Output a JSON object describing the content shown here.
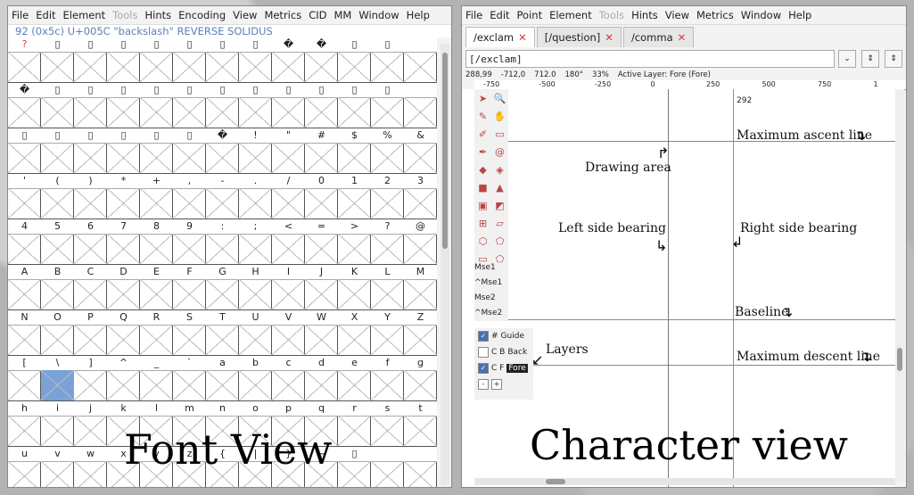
{
  "font_view": {
    "menu": [
      "File",
      "Edit",
      "Element",
      "Tools",
      "Hints",
      "Encoding",
      "View",
      "Metrics",
      "CID",
      "MM",
      "Window",
      "Help"
    ],
    "disabled_menu": [
      "Tools"
    ],
    "info_line": "92 (0x5c) U+005C \"backslash\" REVERSE SOLIDUS",
    "rows": [
      [
        "?",
        "▯",
        "▯",
        "▯",
        "▯",
        "▯",
        "▯",
        "▯",
        "�",
        "�",
        "▯",
        "▯"
      ],
      [
        "�",
        "▯",
        "▯",
        "▯",
        "▯",
        "▯",
        "▯",
        "▯",
        "▯",
        "▯",
        "▯",
        "▯"
      ],
      [
        "▯",
        "▯",
        "▯",
        "▯",
        "▯",
        "▯",
        "�",
        "!",
        "\"",
        "#",
        "$",
        "%",
        "&"
      ],
      [
        "'",
        "(",
        ")",
        "*",
        "+",
        ",",
        "-",
        ".",
        "/",
        "0",
        "1",
        "2",
        "3"
      ],
      [
        "4",
        "5",
        "6",
        "7",
        "8",
        "9",
        ":",
        ";",
        "<",
        "=",
        ">",
        "?",
        "@"
      ],
      [
        "A",
        "B",
        "C",
        "D",
        "E",
        "F",
        "G",
        "H",
        "I",
        "J",
        "K",
        "L",
        "M"
      ],
      [
        "N",
        "O",
        "P",
        "Q",
        "R",
        "S",
        "T",
        "U",
        "V",
        "W",
        "X",
        "Y",
        "Z"
      ],
      [
        "[",
        "\\",
        "]",
        "^",
        "_",
        "`",
        "a",
        "b",
        "c",
        "d",
        "e",
        "f",
        "g"
      ],
      [
        "h",
        "i",
        "j",
        "k",
        "l",
        "m",
        "n",
        "o",
        "p",
        "q",
        "r",
        "s",
        "t"
      ],
      [
        "u",
        "v",
        "w",
        "x",
        "y",
        "z",
        "{",
        "|",
        "}",
        "~",
        "▯",
        "",
        ""
      ]
    ],
    "selected_cell": [
      7,
      1
    ],
    "annotation": "Font View"
  },
  "char_view": {
    "menu": [
      "File",
      "Edit",
      "Point",
      "Element",
      "Tools",
      "Hints",
      "View",
      "Metrics",
      "Window",
      "Help"
    ],
    "disabled_menu": [
      "Tools"
    ],
    "tabs": [
      {
        "label": "/exclam",
        "active": true
      },
      {
        "label": "[/question]",
        "active": false
      },
      {
        "label": "/comma",
        "active": false
      }
    ],
    "glyph_field": "[/exclam]",
    "status": [
      "288,99",
      "-712,0",
      "712.0",
      "180°",
      "33%",
      "Active Layer: Fore (Fore)"
    ],
    "ruler_ticks": [
      "-750",
      "-500",
      "-250",
      "0",
      "250",
      "500",
      "750",
      "1"
    ],
    "top_value": "292",
    "mse": [
      "Mse1",
      "^Mse1",
      "Mse2",
      "^Mse2"
    ],
    "layers": [
      {
        "checked": true,
        "code": "#",
        "name": "Guide"
      },
      {
        "checked": false,
        "code": "C B",
        "name": "Back"
      },
      {
        "checked": true,
        "code": "C F",
        "name": "Fore"
      }
    ],
    "layer_buttons": [
      "-",
      "+"
    ],
    "annotations": {
      "max_ascent": "Maximum ascent line",
      "drawing_area": "Drawing area",
      "lsb": "Left side bearing",
      "rsb": "Right side bearing",
      "baseline": "Baseline",
      "max_descent": "Maximum descent line",
      "layers": "Layers"
    },
    "big_label": "Character view"
  },
  "colors": {
    "selected": "#7ba2d8",
    "info": "#5d7fb7",
    "guide_green": "#3cc25a"
  }
}
